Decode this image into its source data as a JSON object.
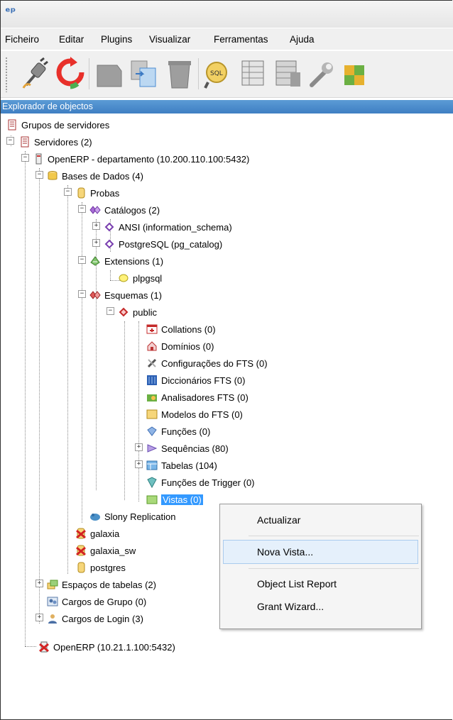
{
  "app_icon": "ᵉᵖ",
  "menu": {
    "items": [
      "Ficheiro",
      "Editar",
      "Plugins",
      "Visualizar",
      "Ferramentas",
      "Ajuda"
    ]
  },
  "toolbar": {
    "buttons": [
      "connect-plug-icon",
      "refresh-icon",
      "object-icon",
      "copy-icon",
      "delete-icon",
      "sql-query-icon",
      "view-data-icon",
      "filter-data-icon",
      "maintenance-wrench-icon",
      "plugins-puzzle-icon"
    ]
  },
  "panel": {
    "title": "Explorador de objectos"
  },
  "tree": {
    "server_groups": "Grupos de servidores",
    "servers": "Servidores (2)",
    "server1": "OpenERP - departamento (10.200.110.100:5432)",
    "databases": "Bases de Dados (4)",
    "db_probas": "Probas",
    "catalogs": "Catálogos (2)",
    "catalog_ansi": "ANSI (information_schema)",
    "catalog_pg": "PostgreSQL (pg_catalog)",
    "extensions": "Extensions (1)",
    "ext_plpgsql": "plpgsql",
    "schemas": "Esquemas (1)",
    "schema_public": "public",
    "collations": "Collations (0)",
    "domains": "Domínios (0)",
    "fts_configs": "Configurações do FTS (0)",
    "fts_dicts": "Diccionários FTS (0)",
    "fts_parsers": "Analisadores FTS (0)",
    "fts_templates": "Modelos do FTS (0)",
    "functions": "Funções (0)",
    "sequences": "Sequências (80)",
    "tables": "Tabelas (104)",
    "trigger_functions": "Funções de Trigger (0)",
    "views": "Vistas (0)",
    "slony": "Slony Replication",
    "db_galaxia": "galaxia",
    "db_galaxia_sw": "galaxia_sw",
    "db_postgres": "postgres",
    "tablespaces": "Espaços de tabelas (2)",
    "group_roles": "Cargos de Grupo (0)",
    "login_roles": "Cargos de Login (3)",
    "server2": "OpenERP (10.21.1.100:5432)"
  },
  "context_menu": {
    "items": [
      "Actualizar",
      "Nova Vista...",
      "Object List Report",
      "Grant Wizard..."
    ],
    "highlighted": "Nova Vista..."
  }
}
